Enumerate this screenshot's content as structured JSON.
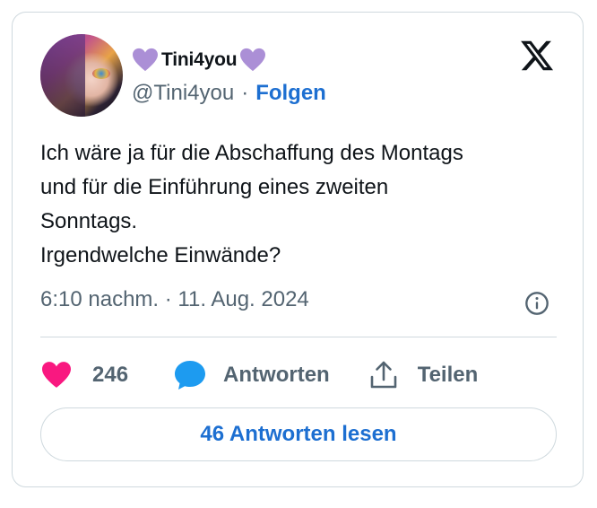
{
  "author": {
    "display_name": "Tini4you",
    "handle": "@Tini4you",
    "separator": "·",
    "follow_label": "Folgen"
  },
  "tweet": {
    "lines": [
      "Ich wäre ja für die Abschaffung des Montags",
      "und für die Einführung eines zweiten",
      "Sonntags.",
      "Irgendwelche Einwände?"
    ],
    "timestamp": "6:10 nachm. · 11. Aug. 2024"
  },
  "actions": {
    "like_count": "246",
    "reply_label": "Antworten",
    "share_label": "Teilen"
  },
  "read_replies_label": "46 Antworten lesen",
  "colors": {
    "accent_blue": "#1d6fd1",
    "heart_red": "#f91880",
    "emoji_heart_purple": "#ab8fd6",
    "muted_text": "#536471",
    "border": "#cfd9de"
  },
  "icons": [
    "purple-heart-icon",
    "x-logo-icon",
    "info-icon",
    "heart-icon",
    "reply-bubble-icon",
    "share-icon"
  ]
}
